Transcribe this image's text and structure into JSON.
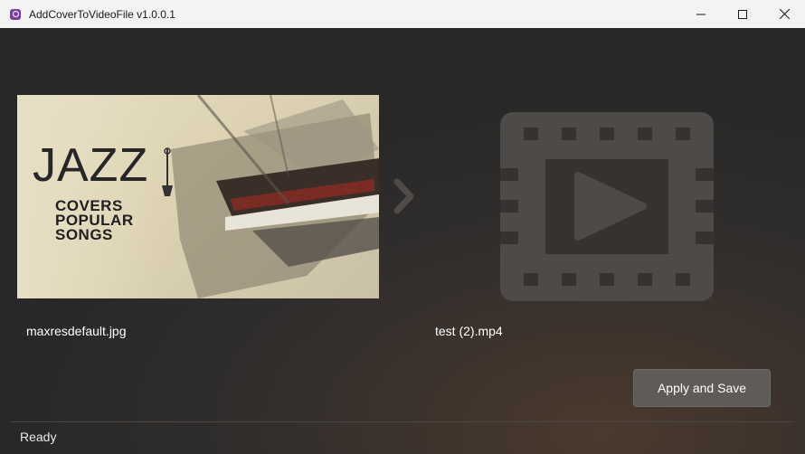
{
  "window": {
    "title": "AddCoverToVideoFile v1.0.0.1",
    "controls": [
      "minimize-icon",
      "maximize-icon",
      "close-icon"
    ]
  },
  "cover": {
    "file_name": "maxresdefault.jpg",
    "headline": "JAZZ",
    "subtitle_lines": [
      "COVERS",
      "POPULAR",
      "SONGS"
    ]
  },
  "video": {
    "file_name": "test (2).mp4",
    "icon": "video-film-icon"
  },
  "actions": {
    "apply_label": "Apply and Save"
  },
  "status": {
    "text": "Ready"
  },
  "colors": {
    "accent_icon": "#7b3fa8",
    "button_bg": "#5f5b58",
    "placeholder_icon": "#4d4a48"
  }
}
